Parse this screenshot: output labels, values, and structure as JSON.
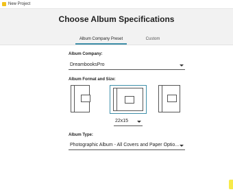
{
  "window": {
    "title": "New Project"
  },
  "header": {
    "title": "Choose Album Specifications"
  },
  "tabs": [
    {
      "label": "Album Company Preset",
      "selected": true
    },
    {
      "label": "Custom",
      "selected": false
    }
  ],
  "company": {
    "label": "Album Company:",
    "value": "DreambooksPro"
  },
  "format": {
    "label": "Album Format and Size:",
    "size_value": "22x15",
    "options": [
      "portrait",
      "landscape",
      "square"
    ],
    "selected": "landscape"
  },
  "album_type": {
    "label": "Album Type:",
    "value": "Photographic Album - All Covers and Paper Optio..."
  },
  "colors": {
    "accent": "#3d8ea8",
    "header_bg": "#f2f2f2",
    "app_icon": "#f2c21b"
  }
}
